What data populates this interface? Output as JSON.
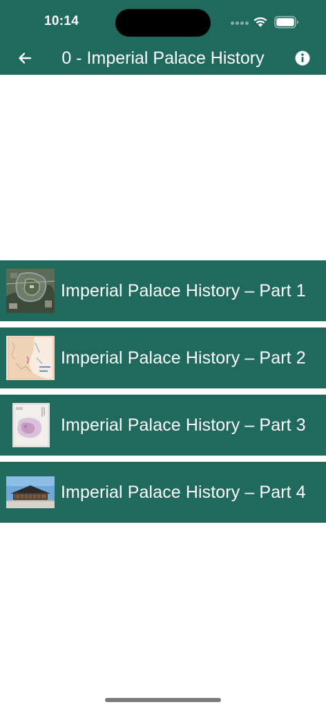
{
  "status_bar": {
    "time": "10:14"
  },
  "app_bar": {
    "title": "0 - Imperial Palace History",
    "back_icon": "arrow-left-icon",
    "info_icon": "info-icon"
  },
  "colors": {
    "primary": "#1f6a5c",
    "text_on_primary": "#ffffff",
    "background": "#ffffff"
  },
  "list": {
    "items": [
      {
        "label": "Imperial Palace History – Part 1",
        "thumbnail": "aerial-satellite-photo"
      },
      {
        "label": "Imperial Palace History – Part 2",
        "thumbnail": "historical-map"
      },
      {
        "label": "Imperial Palace History – Part 3",
        "thumbnail": "scroll-painting"
      },
      {
        "label": "Imperial Palace History – Part 4",
        "thumbnail": "palace-building-photo"
      }
    ]
  }
}
